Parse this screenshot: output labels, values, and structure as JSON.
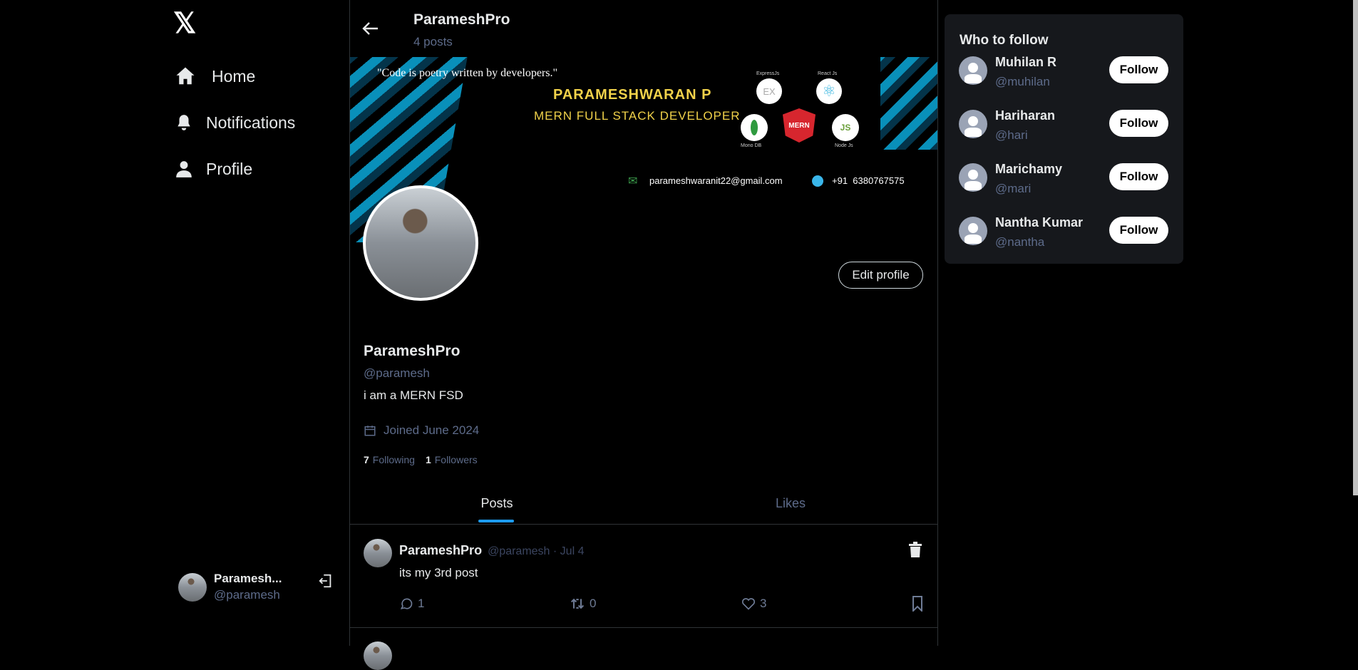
{
  "sidebar": {
    "nav": [
      {
        "label": "Home",
        "icon": "home-icon"
      },
      {
        "label": "Notifications",
        "icon": "bell-icon"
      },
      {
        "label": "Profile",
        "icon": "user-icon"
      }
    ],
    "user": {
      "name": "Paramesh...",
      "handle": "@paramesh"
    }
  },
  "header": {
    "title": "ParameshPro",
    "posts_count": "4 posts"
  },
  "banner": {
    "quote": "\"Code is poetry written by developers.\"",
    "name": "PARAMESHWARAN P",
    "role": "MERN FULL STACK DEVELOPER",
    "email": "parameshwaranit22@gmail.com",
    "phone": "+91  6380767575",
    "tech": [
      "ExpressJs",
      "React Js",
      "Mono DB",
      "Node Js"
    ],
    "badge": "MERN",
    "ex": "EX"
  },
  "profile": {
    "edit_label": "Edit profile",
    "name": "ParameshPro",
    "handle": "@paramesh",
    "bio": "i am a MERN FSD",
    "joined": "Joined June 2024",
    "following_count": "7",
    "following_label": "Following",
    "followers_count": "1",
    "followers_label": "Followers"
  },
  "tabs": [
    {
      "label": "Posts",
      "active": true
    },
    {
      "label": "Likes",
      "active": false
    }
  ],
  "posts": [
    {
      "name": "ParameshPro",
      "meta": "@paramesh · Jul 4",
      "text": "its my 3rd post",
      "comments": "1",
      "reposts": "0",
      "likes": "3"
    }
  ],
  "who_to_follow": {
    "title": "Who to follow",
    "follow_label": "Follow",
    "users": [
      {
        "name": "Muhilan R",
        "handle": "@muhilan"
      },
      {
        "name": "Hariharan",
        "handle": "@hari"
      },
      {
        "name": "Marichamy",
        "handle": "@mari"
      },
      {
        "name": "Nantha Kumar",
        "handle": "@nantha"
      }
    ]
  },
  "colors": {
    "accent": "#1d9bf0",
    "muted": "#5d6b8a",
    "card": "#16181c"
  }
}
